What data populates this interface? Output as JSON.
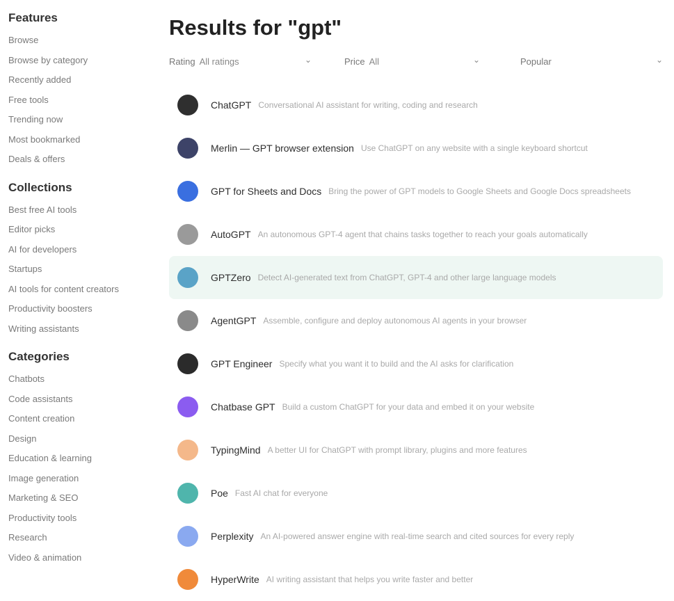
{
  "page": {
    "title": "Results for \"gpt\""
  },
  "filters": {
    "rating": {
      "label": "Rating",
      "value": "All ratings"
    },
    "price": {
      "label": "Price",
      "value": "All"
    },
    "sort": {
      "label": "Popular",
      "value": ""
    }
  },
  "sidebar": {
    "sections": [
      {
        "title": "Features",
        "items": [
          "Browse",
          "Browse by category",
          "Recently added",
          "Free tools",
          "Trending now",
          "Most bookmarked",
          "Deals & offers"
        ]
      },
      {
        "title": "Collections",
        "items": [
          "Best free AI tools",
          "Editor picks",
          "AI for developers",
          "Startups",
          "AI tools for content creators",
          "Productivity boosters",
          "Writing assistants"
        ]
      },
      {
        "title": "Categories",
        "items": [
          "Chatbots",
          "Code assistants",
          "Content creation",
          "Design",
          "Education & learning",
          "Image generation",
          "Marketing & SEO",
          "Productivity tools",
          "Research",
          "Video & animation"
        ]
      }
    ]
  },
  "results": [
    {
      "name": "ChatGPT",
      "desc": "Conversational AI assistant for writing, coding and research",
      "icon": "chatgpt-logo-icon",
      "color": "#2f2f2f",
      "highlight": false
    },
    {
      "name": "Merlin — GPT browser extension",
      "desc": "Use ChatGPT on any website with a single keyboard shortcut",
      "icon": "merlin-logo-icon",
      "color": "#3d4368",
      "highlight": false
    },
    {
      "name": "GPT for Sheets and Docs",
      "desc": "Bring the power of GPT models to Google Sheets and Google Docs spreadsheets",
      "icon": "sheets-docs-logo-icon",
      "color": "#3a6fe0",
      "highlight": false
    },
    {
      "name": "AutoGPT",
      "desc": "An autonomous GPT-4 agent that chains tasks together to reach your goals automatically",
      "icon": "autogpt-logo-icon",
      "color": "#9a9a9a",
      "highlight": false
    },
    {
      "name": "GPTZero",
      "desc": "Detect AI-generated text from ChatGPT, GPT-4 and other large language models",
      "icon": "gptzero-logo-icon",
      "color": "#5aa3c7",
      "highlight": true
    },
    {
      "name": "AgentGPT",
      "desc": "Assemble, configure and deploy autonomous AI agents in your browser",
      "icon": "agentgpt-logo-icon",
      "color": "#8a8a8a",
      "highlight": false
    },
    {
      "name": "GPT Engineer",
      "desc": "Specify what you want it to build and the AI asks for clarification",
      "icon": "gpt-engineer-logo-icon",
      "color": "#2b2b2b",
      "highlight": false
    },
    {
      "name": "Chatbase GPT",
      "desc": "Build a custom ChatGPT for your data and embed it on your website",
      "icon": "chatbase-logo-icon",
      "color": "#8b5cf0",
      "highlight": false
    },
    {
      "name": "TypingMind",
      "desc": "A better UI for ChatGPT with prompt library, plugins and more features",
      "icon": "typingmind-logo-icon",
      "color": "#f4b88a",
      "highlight": false
    },
    {
      "name": "Poe",
      "desc": "Fast AI chat for everyone",
      "icon": "poe-logo-icon",
      "color": "#4fb5ac",
      "highlight": false
    },
    {
      "name": "Perplexity",
      "desc": "An AI-powered answer engine with real-time search and cited sources for every reply",
      "icon": "perplexity-logo-icon",
      "color": "#8aa9f0",
      "highlight": false
    },
    {
      "name": "HyperWrite",
      "desc": "AI writing assistant that helps you write faster and better",
      "icon": "hyperwrite-logo-icon",
      "color": "#f08a3a",
      "highlight": false
    }
  ]
}
